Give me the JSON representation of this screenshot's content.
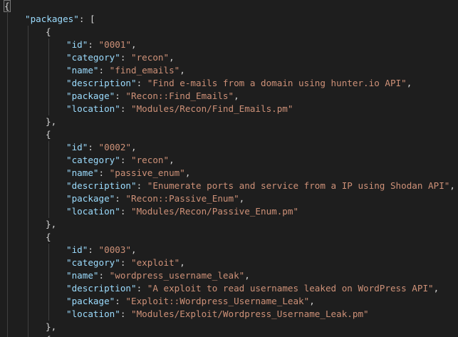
{
  "editor": {
    "root_key": "packages",
    "packages": [
      {
        "id": "0001",
        "category": "recon",
        "name": "find_emails",
        "description": "Find e-mails from a domain using hunter.io API",
        "package": "Recon::Find_Emails",
        "location": "Modules/Recon/Find_Emails.pm"
      },
      {
        "id": "0002",
        "category": "recon",
        "name": "passive_enum",
        "description": "Enumerate ports and service from a IP using Shodan API",
        "package": "Recon::Passive_Enum",
        "location": "Modules/Recon/Passive_Enum.pm"
      },
      {
        "id": "0003",
        "category": "exploit",
        "name": "wordpress_username_leak",
        "description": "A exploit to read usernames leaked on WordPress API",
        "package": "Exploit::Wordpress_Username_Leak",
        "location": "Modules/Exploit/Wordpress_Username_Leak.pm"
      }
    ],
    "field_order": [
      "id",
      "category",
      "name",
      "description",
      "package",
      "location"
    ]
  }
}
